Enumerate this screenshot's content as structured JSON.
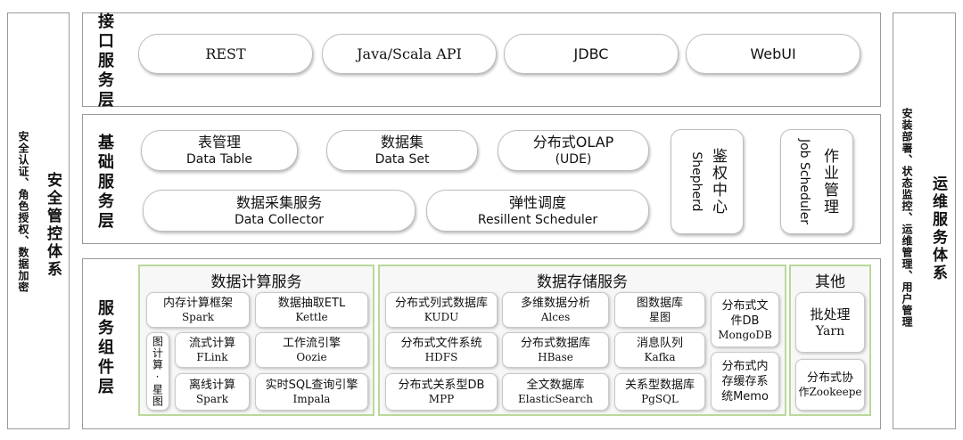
{
  "left_panel": {
    "title": "安全管控体系",
    "items": "安全认证、角色授权、数据加密"
  },
  "right_panel": {
    "title": "运维服务体系",
    "items": "安装部署、状态监控、运维管理、用户管理"
  },
  "interface_layer": {
    "label": "接口服务层",
    "items": [
      "REST",
      "Java/Scala API",
      "JDBC",
      "WebUI"
    ]
  },
  "base_layer": {
    "label": "基础服务层",
    "items": [
      {
        "zh": "表管理",
        "en": "Data Table"
      },
      {
        "zh": "数据集",
        "en": "Data Set"
      },
      {
        "zh": "分布式OLAP",
        "en": "(UDE)"
      },
      {
        "zh": "数据采集服务",
        "en": "Data Collector"
      },
      {
        "zh": "弹性调度",
        "en": "Resillent  Scheduler"
      },
      {
        "zh": "鉴权中心",
        "en": "Shepherd"
      },
      {
        "zh": "作业管理",
        "en": "Job Scheduler"
      }
    ]
  },
  "component_layer": {
    "label": "服务组件层",
    "compute": {
      "title": "数据计算服务",
      "items": [
        {
          "zh": "内存计算框架",
          "en": "Spark"
        },
        {
          "zh": "数据抽取ETL",
          "en": "Kettle"
        },
        {
          "zh": "流式计算",
          "en": "FLink"
        },
        {
          "zh": "工作流引擎",
          "en": "Oozie"
        },
        {
          "zh": "离线计算",
          "en": "Spark"
        },
        {
          "zh": "实时SQL查询引擎",
          "en": "Impala"
        }
      ],
      "graph": "图计算·星图"
    },
    "storage": {
      "title": "数据存储服务",
      "items": [
        {
          "zh": "分布式列式数据库",
          "en": "KUDU"
        },
        {
          "zh": "多维数据分析",
          "en": "Alces"
        },
        {
          "zh": "图数据库",
          "en": "星图"
        },
        {
          "zh": "分布式文件系统",
          "en": "HDFS"
        },
        {
          "zh": "分布式数据库",
          "en": "HBase"
        },
        {
          "zh": "消息队列",
          "en": "Kafka"
        },
        {
          "zh": "分布式关系型DB",
          "en": "MPP"
        },
        {
          "zh": "全文数据库",
          "en": "ElasticSearch"
        },
        {
          "zh": "关系型数据库",
          "en": "PgSQL"
        }
      ],
      "mongo": {
        "l1": "分布式文",
        "l2": "件DB",
        "l3": "MongoDB"
      },
      "memo": {
        "l1": "分布式内",
        "l2": "存缓存系",
        "l3": "统Memo"
      }
    },
    "other": {
      "title": "其他",
      "batch": {
        "zh": "批处理",
        "en": "Yarn"
      },
      "coord": {
        "l1": "分布式协",
        "l2": "作Zookeepe"
      }
    }
  }
}
